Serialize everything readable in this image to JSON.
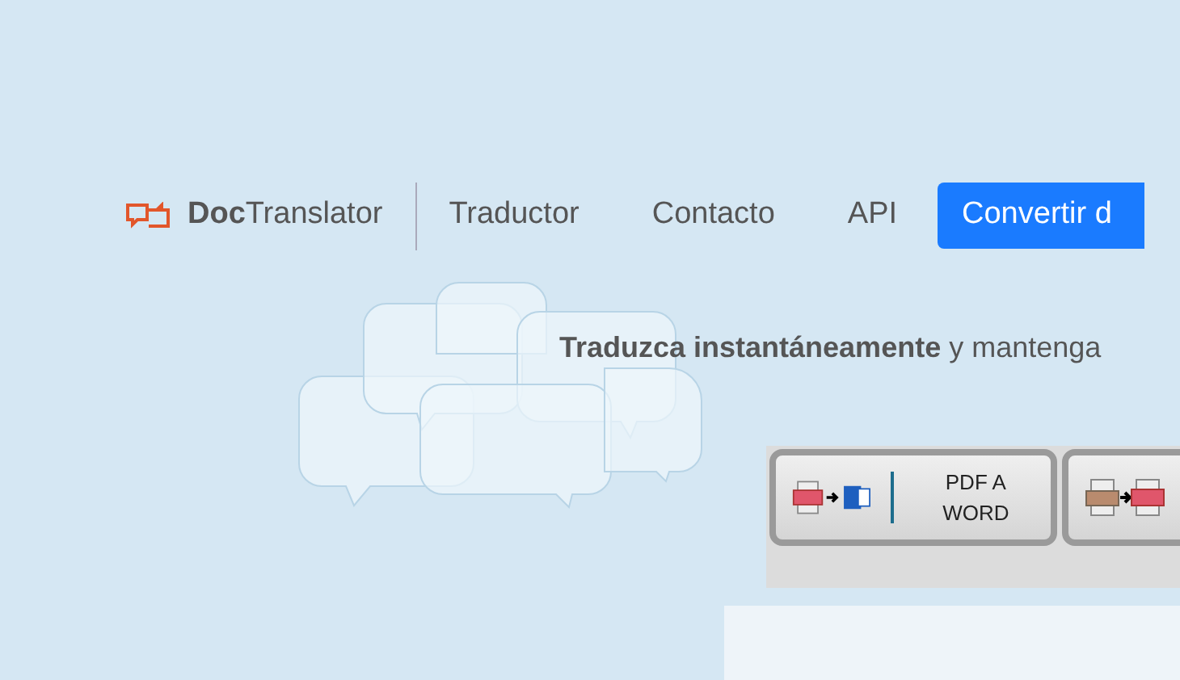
{
  "nav": {
    "logo": {
      "bold": "Doc",
      "rest": "Translator"
    },
    "links": [
      {
        "label": "Traductor"
      },
      {
        "label": "Contacto"
      },
      {
        "label": "API"
      }
    ],
    "cta": "Convertir d"
  },
  "tagline": {
    "bold": "Traduzca instantáneamente",
    "rest": "y mantenga"
  },
  "converters": [
    {
      "kind": "pdf-word",
      "label": "PDF A WORD"
    },
    {
      "kind": "jpg-pdf"
    }
  ]
}
